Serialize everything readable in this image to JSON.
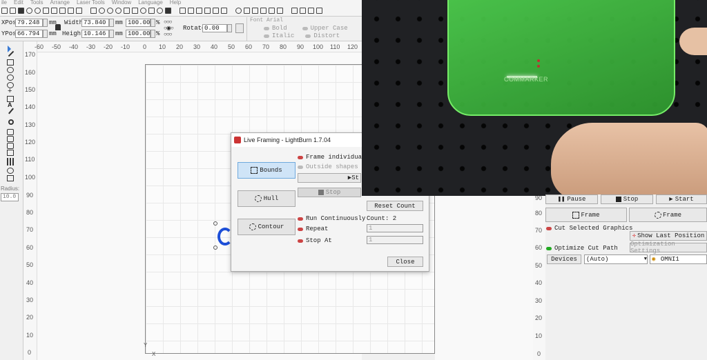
{
  "menu": [
    "ile",
    "Edit",
    "Tools",
    "Arrange",
    "Laser Tools",
    "Window",
    "Language",
    "Help"
  ],
  "props": {
    "xpos_label": "XPos",
    "xpos": "79.248",
    "ypos_label": "YPos",
    "ypos": "66.794",
    "width_label": "Width",
    "width": "73.840",
    "height_label": "Height",
    "height": "10.146",
    "unit": "mm",
    "scale_x": "100.000",
    "scale_y": "100.000",
    "pct": "%",
    "rotate_label": "Rotate",
    "rotate": "0.00",
    "font_label": "Font Arial",
    "bold": "Bold",
    "italic": "Italic",
    "upper": "Upper Case",
    "distort": "Distort"
  },
  "left": {
    "radius_label": "Radius:",
    "radius": "10.0"
  },
  "ruler_h": [
    "-60",
    "-50",
    "-40",
    "-30",
    "-20",
    "-10",
    "0",
    "10",
    "20",
    "30",
    "40",
    "50",
    "60",
    "70",
    "80",
    "90",
    "100",
    "110",
    "120"
  ],
  "ruler_v": [
    "170",
    "160",
    "150",
    "140",
    "130",
    "120",
    "110",
    "100",
    "90",
    "80",
    "70",
    "60",
    "50",
    "40",
    "30",
    "20",
    "10",
    "0"
  ],
  "ruler_v_right": [
    "90",
    "80",
    "70",
    "60",
    "50",
    "40",
    "30",
    "20",
    "10",
    "0"
  ],
  "dialog": {
    "title": "Live Framing - LightBurn 1.7.04",
    "bounds": "Bounds",
    "hull": "Hull",
    "contour": "Contour",
    "frame_individually": "Frame individually",
    "outside_shapes": "Outside shapes only",
    "start": "St",
    "stop": "Stop",
    "reset_count": "Reset Count",
    "run_continuously": "Run Continuously",
    "count": "Count: 2",
    "repeat": "Repeat",
    "repeat_val": "1",
    "stop_at": "Stop At",
    "stop_at_val": "1",
    "close": "Close"
  },
  "photo": {
    "brand": "COMMARKER"
  },
  "laser": {
    "pause": "Pause",
    "stop": "Stop",
    "start": "Start",
    "frame1": "Frame",
    "frame2": "Frame",
    "cut_selected": "Cut Selected Graphics",
    "show_last": "Show Last Position",
    "optimize": "Optimize Cut Path",
    "opt_settings": "Optimization Settings",
    "devices": "Devices",
    "auto": "(Auto)",
    "device": "OMNI1"
  }
}
